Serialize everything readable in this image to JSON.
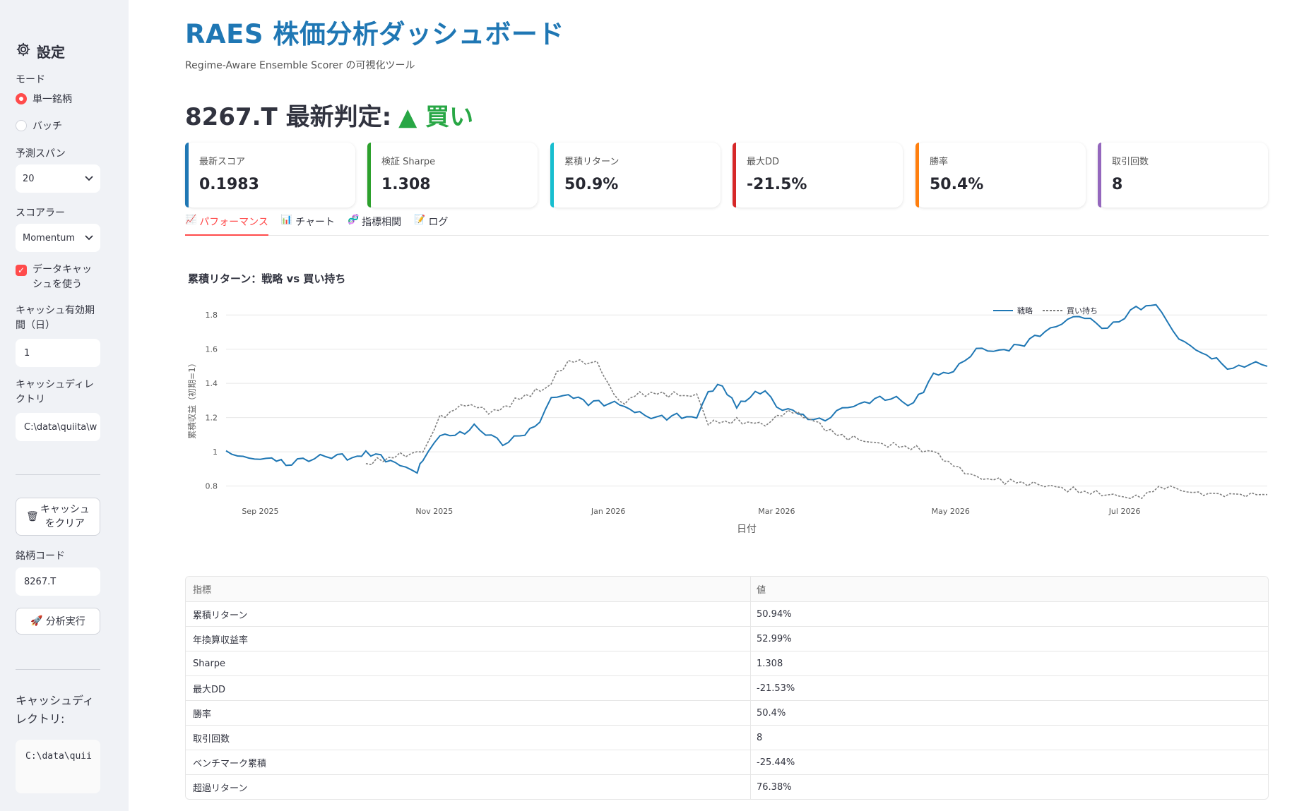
{
  "sidebar": {
    "header": "設定",
    "mode_label": "モード",
    "mode_options": [
      "単一銘柄",
      "バッチ"
    ],
    "span_label": "予測スパン",
    "span_value": "20",
    "scorer_label": "スコアラー",
    "scorer_value": "Momentum",
    "cache_checkbox_label": "データキャッシュを使う",
    "cache_days_label": "キャッシュ有効期間（日）",
    "cache_days_value": "1",
    "cache_dir_label": "キャッシュディレクトリ",
    "cache_dir_value": "C:\\data\\quiita\\w",
    "clear_cache_button": "キャッシュをクリア",
    "ticker_label": "銘柄コード",
    "ticker_value": "8267.T",
    "run_button": "分析実行",
    "cache_dir_info_label": "キャッシュディレクトリ:",
    "cache_dir_info_value": "C:\\data\\quii"
  },
  "header": {
    "title": "RAES 株価分析ダッシュボード",
    "subtitle": "Regime-Aware Ensemble Scorer の可視化ツール"
  },
  "verdict": {
    "prefix": "8267.T 最新判定:",
    "signal": "▲ 買い",
    "signal_color": "#28a745"
  },
  "metrics": [
    {
      "label": "最新スコア",
      "value": "0.1983",
      "accent": "#1f77b4"
    },
    {
      "label": "検証 Sharpe",
      "value": "1.308",
      "accent": "#2ca02c"
    },
    {
      "label": "累積リターン",
      "value": "50.9%",
      "accent": "#17becf"
    },
    {
      "label": "最大DD",
      "value": "-21.5%",
      "accent": "#d62728"
    },
    {
      "label": "勝率",
      "value": "50.4%",
      "accent": "#ff7f0e"
    },
    {
      "label": "取引回数",
      "value": "8",
      "accent": "#9467bd"
    }
  ],
  "tabs": [
    {
      "icon": "📈",
      "label": "パフォーマンス"
    },
    {
      "icon": "📊",
      "label": "チャート"
    },
    {
      "icon": "🧬",
      "label": "指標相関"
    },
    {
      "icon": "📝",
      "label": "ログ"
    }
  ],
  "chart_title": "累積リターン：戦略 vs 買い持ち",
  "chart_data": {
    "type": "line",
    "xlabel": "日付",
    "ylabel": "累積収益（初期=1）",
    "ylim": [
      0.72,
      1.9
    ],
    "yticks": [
      0.8,
      1,
      1.2,
      1.4,
      1.6,
      1.8
    ],
    "xlim": [
      "2025-08-20",
      "2026-08-20"
    ],
    "xticks": [
      {
        "date": "2025-09-01",
        "label": "Sep 2025"
      },
      {
        "date": "2025-11-01",
        "label": "Nov 2025"
      },
      {
        "date": "2026-01-01",
        "label": "Jan 2026"
      },
      {
        "date": "2026-03-01",
        "label": "Mar 2026"
      },
      {
        "date": "2026-05-01",
        "label": "May 2026"
      },
      {
        "date": "2026-07-01",
        "label": "Jul 2026"
      }
    ],
    "legend_position": "top-right",
    "grid": true,
    "series": [
      {
        "name": "戦略",
        "color": "#1f77b4",
        "dash": false,
        "points": [
          [
            "2025-08-20",
            1.0
          ],
          [
            "2025-08-28",
            0.96
          ],
          [
            "2025-09-05",
            0.96
          ],
          [
            "2025-09-10",
            0.93
          ],
          [
            "2025-09-18",
            0.96
          ],
          [
            "2025-09-28",
            0.98
          ],
          [
            "2025-10-05",
            0.96
          ],
          [
            "2025-10-08",
            1.0
          ],
          [
            "2025-10-15",
            0.96
          ],
          [
            "2025-10-20",
            0.92
          ],
          [
            "2025-10-26",
            0.88
          ],
          [
            "2025-10-28",
            0.95
          ],
          [
            "2025-11-03",
            1.1
          ],
          [
            "2025-11-10",
            1.1
          ],
          [
            "2025-11-15",
            1.15
          ],
          [
            "2025-11-25",
            1.05
          ],
          [
            "2025-12-01",
            1.09
          ],
          [
            "2025-12-08",
            1.17
          ],
          [
            "2025-12-12",
            1.32
          ],
          [
            "2025-12-18",
            1.33
          ],
          [
            "2025-12-25",
            1.29
          ],
          [
            "2026-01-05",
            1.28
          ],
          [
            "2026-01-12",
            1.22
          ],
          [
            "2026-01-18",
            1.2
          ],
          [
            "2026-01-25",
            1.21
          ],
          [
            "2026-02-01",
            1.2
          ],
          [
            "2026-02-05",
            1.35
          ],
          [
            "2026-02-10",
            1.39
          ],
          [
            "2026-02-15",
            1.26
          ],
          [
            "2026-02-18",
            1.31
          ],
          [
            "2026-02-25",
            1.36
          ],
          [
            "2026-03-01",
            1.26
          ],
          [
            "2026-03-05",
            1.25
          ],
          [
            "2026-03-12",
            1.2
          ],
          [
            "2026-03-18",
            1.18
          ],
          [
            "2026-03-22",
            1.24
          ],
          [
            "2026-03-30",
            1.28
          ],
          [
            "2026-04-08",
            1.32
          ],
          [
            "2026-04-18",
            1.28
          ],
          [
            "2026-04-25",
            1.45
          ],
          [
            "2026-05-02",
            1.47
          ],
          [
            "2026-05-10",
            1.6
          ],
          [
            "2026-05-18",
            1.59
          ],
          [
            "2026-05-25",
            1.62
          ],
          [
            "2026-06-05",
            1.72
          ],
          [
            "2026-06-15",
            1.8
          ],
          [
            "2026-06-25",
            1.72
          ],
          [
            "2026-07-05",
            1.84
          ],
          [
            "2026-07-12",
            1.86
          ],
          [
            "2026-07-20",
            1.66
          ],
          [
            "2026-07-28",
            1.58
          ],
          [
            "2026-08-04",
            1.52
          ],
          [
            "2026-08-08",
            1.48
          ],
          [
            "2026-08-14",
            1.52
          ],
          [
            "2026-08-20",
            1.5
          ]
        ]
      },
      {
        "name": "買い持ち",
        "color": "#7f7f7f",
        "dash": true,
        "points": [
          [
            "2025-10-08",
            0.93
          ],
          [
            "2025-10-20",
            0.98
          ],
          [
            "2025-10-28",
            1.0
          ],
          [
            "2025-11-03",
            1.2
          ],
          [
            "2025-11-12",
            1.28
          ],
          [
            "2025-11-22",
            1.23
          ],
          [
            "2025-12-03",
            1.33
          ],
          [
            "2025-12-10",
            1.37
          ],
          [
            "2025-12-18",
            1.53
          ],
          [
            "2025-12-28",
            1.52
          ],
          [
            "2026-01-05",
            1.28
          ],
          [
            "2026-01-12",
            1.34
          ],
          [
            "2026-01-20",
            1.34
          ],
          [
            "2026-01-28",
            1.33
          ],
          [
            "2026-02-01",
            1.33
          ],
          [
            "2026-02-05",
            1.17
          ],
          [
            "2026-02-15",
            1.18
          ],
          [
            "2026-02-25",
            1.16
          ],
          [
            "2026-03-05",
            1.24
          ],
          [
            "2026-03-12",
            1.2
          ],
          [
            "2026-03-22",
            1.1
          ],
          [
            "2026-04-05",
            1.05
          ],
          [
            "2026-04-15",
            1.03
          ],
          [
            "2026-04-25",
            1.0
          ],
          [
            "2026-05-02",
            0.92
          ],
          [
            "2026-05-10",
            0.85
          ],
          [
            "2026-05-20",
            0.83
          ],
          [
            "2026-06-05",
            0.8
          ],
          [
            "2026-06-15",
            0.77
          ],
          [
            "2026-06-25",
            0.75
          ],
          [
            "2026-07-05",
            0.73
          ],
          [
            "2026-07-15",
            0.8
          ],
          [
            "2026-07-25",
            0.76
          ],
          [
            "2026-08-05",
            0.75
          ],
          [
            "2026-08-20",
            0.75
          ]
        ]
      }
    ]
  },
  "table": {
    "headers": [
      "指標",
      "値"
    ],
    "rows": [
      [
        "累積リターン",
        "50.94%"
      ],
      [
        "年換算収益率",
        "52.99%"
      ],
      [
        "Sharpe",
        "1.308"
      ],
      [
        "最大DD",
        "-21.53%"
      ],
      [
        "勝率",
        "50.4%"
      ],
      [
        "取引回数",
        "8"
      ],
      [
        "ベンチマーク累積",
        "-25.44%"
      ],
      [
        "超過リターン",
        "76.38%"
      ]
    ]
  }
}
